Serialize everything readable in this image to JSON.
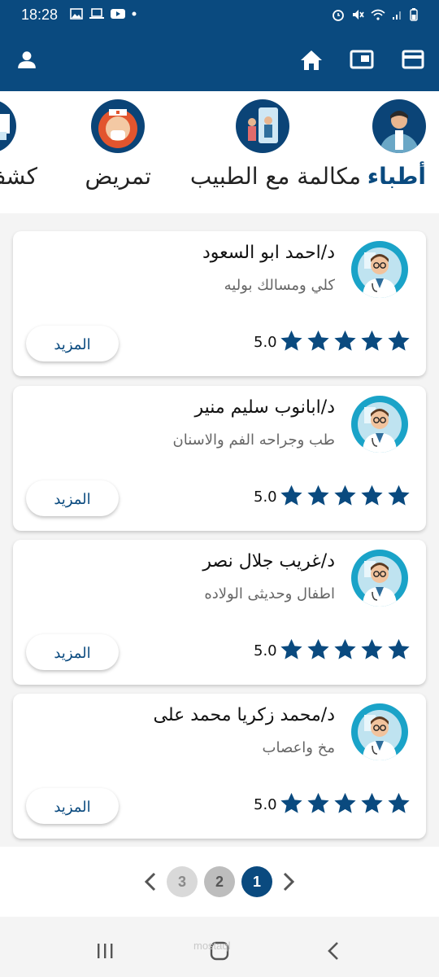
{
  "status": {
    "time": "18:28"
  },
  "categories": [
    {
      "label": "أطباء",
      "icon": "doctor-icon"
    },
    {
      "label": "مكالمة مع الطبيب",
      "icon": "video-call-icon"
    },
    {
      "label": "تمريض",
      "icon": "nurse-icon"
    },
    {
      "label": "كشف",
      "icon": "checkup-icon"
    }
  ],
  "doctors": [
    {
      "name": "د/احمد ابو السعود",
      "specialty": "كلي ومسالك بوليه",
      "rating": "5.0",
      "stars": 5,
      "more": "المزيد"
    },
    {
      "name": "د/ابانوب  سليم منير",
      "specialty": "طب وجراحه الفم والاسنان",
      "rating": "5.0",
      "stars": 5,
      "more": "المزيد"
    },
    {
      "name": "د/غريب جلال نصر",
      "specialty": "اطفال وحديثى الولاده",
      "rating": "5.0",
      "stars": 5,
      "more": "المزيد"
    },
    {
      "name": "د/محمد زكريا محمد على",
      "specialty": "مخ واعصاب",
      "rating": "5.0",
      "stars": 5,
      "more": "المزيد"
    }
  ],
  "pagination": {
    "pages": [
      "1",
      "2",
      "3"
    ],
    "current": "1"
  },
  "watermark": "mostaql",
  "colors": {
    "primary": "#0a4a7f",
    "star": "#0a4a7f",
    "avatar_bg": "#1aa3c8"
  }
}
